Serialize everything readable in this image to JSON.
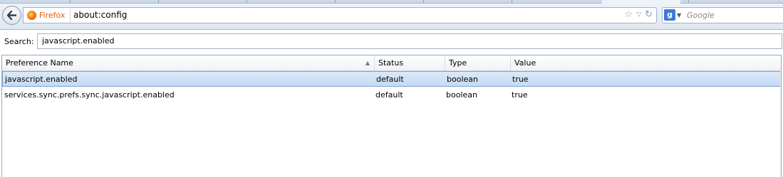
{
  "nav": {
    "identity_label": "Firefox",
    "url": "about:config",
    "search_engine": "Google",
    "search_placeholder": "Google"
  },
  "filter": {
    "label": "Search:",
    "value": "javascript.enabled"
  },
  "table": {
    "columns": [
      "Preference Name",
      "Status",
      "Type",
      "Value"
    ],
    "sorted_column": "Preference Name",
    "sort_direction": "ascending",
    "rows": [
      {
        "name": "javascript.enabled",
        "status": "default",
        "type": "boolean",
        "value": "true",
        "selected": true
      },
      {
        "name": "services.sync.prefs.sync.javascript.enabled",
        "status": "default",
        "type": "boolean",
        "value": "true",
        "selected": false
      }
    ]
  },
  "icons": {
    "back": "back-arrow-icon",
    "firefox": "firefox-logo-icon",
    "bookmark": "star-icon",
    "history": "dropdown-arrow-icon",
    "reload": "reload-icon",
    "engine": "google-logo-icon"
  }
}
